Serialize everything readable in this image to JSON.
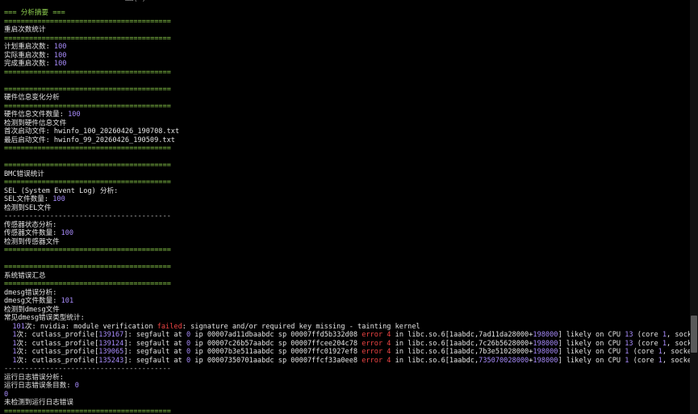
{
  "top_clip": "……(  )",
  "lines": [
    {
      "segs": [
        {
          "t": "=== 分析摘要 ===",
          "c": "g"
        }
      ]
    },
    {
      "segs": [
        {
          "t": "========================================",
          "c": "sep-g"
        }
      ]
    },
    {
      "segs": [
        {
          "t": "重启次数统计",
          "c": "t"
        }
      ]
    },
    {
      "segs": [
        {
          "t": "========================================",
          "c": "sep-g"
        }
      ]
    },
    {
      "segs": [
        {
          "t": "计划重启次数: ",
          "c": "t"
        },
        {
          "t": "100",
          "c": "n"
        }
      ]
    },
    {
      "segs": [
        {
          "t": "实际重启次数: ",
          "c": "t"
        },
        {
          "t": "100",
          "c": "n"
        }
      ]
    },
    {
      "segs": [
        {
          "t": "完成重启次数: ",
          "c": "t"
        },
        {
          "t": "100",
          "c": "n"
        }
      ]
    },
    {
      "segs": [
        {
          "t": "========================================",
          "c": "sep-g"
        }
      ]
    },
    {
      "segs": [
        {
          "t": "",
          "c": "t"
        }
      ]
    },
    {
      "segs": [
        {
          "t": "========================================",
          "c": "sep-g"
        }
      ]
    },
    {
      "segs": [
        {
          "t": "硬件信息变化分析",
          "c": "t"
        }
      ]
    },
    {
      "segs": [
        {
          "t": "========================================",
          "c": "sep-g"
        }
      ]
    },
    {
      "segs": [
        {
          "t": "硬件信息文件数量: ",
          "c": "t"
        },
        {
          "t": "100",
          "c": "n"
        }
      ]
    },
    {
      "segs": [
        {
          "t": "检测到硬件信息文件",
          "c": "t"
        }
      ]
    },
    {
      "segs": [
        {
          "t": "首次启动文件: hwinfo_100_20260426_190708.txt",
          "c": "t"
        }
      ]
    },
    {
      "segs": [
        {
          "t": "最后启动文件: hwinfo_99_20260426_190509.txt",
          "c": "t"
        }
      ]
    },
    {
      "segs": [
        {
          "t": "========================================",
          "c": "sep-g"
        }
      ]
    },
    {
      "segs": [
        {
          "t": "",
          "c": "t"
        }
      ]
    },
    {
      "segs": [
        {
          "t": "========================================",
          "c": "sep-g"
        }
      ]
    },
    {
      "segs": [
        {
          "t": "BMC错误统计",
          "c": "t"
        }
      ]
    },
    {
      "segs": [
        {
          "t": "========================================",
          "c": "sep-g"
        }
      ]
    },
    {
      "segs": [
        {
          "t": "SEL (System Event Log) 分析:",
          "c": "t"
        }
      ]
    },
    {
      "segs": [
        {
          "t": "SEL文件数量: ",
          "c": "t"
        },
        {
          "t": "100",
          "c": "n"
        }
      ]
    },
    {
      "segs": [
        {
          "t": "检测到SEL文件",
          "c": "t"
        }
      ]
    },
    {
      "segs": [
        {
          "t": "----------------------------------------",
          "c": "sep-w"
        }
      ]
    },
    {
      "segs": [
        {
          "t": "传感器状态分析:",
          "c": "t"
        }
      ]
    },
    {
      "segs": [
        {
          "t": "传感器文件数量: ",
          "c": "t"
        },
        {
          "t": "100",
          "c": "n"
        }
      ]
    },
    {
      "segs": [
        {
          "t": "检测到传感器文件",
          "c": "t"
        }
      ]
    },
    {
      "segs": [
        {
          "t": "========================================",
          "c": "sep-g"
        }
      ]
    },
    {
      "segs": [
        {
          "t": "",
          "c": "t"
        }
      ]
    },
    {
      "segs": [
        {
          "t": "========================================",
          "c": "sep-g"
        }
      ]
    },
    {
      "segs": [
        {
          "t": "系统错误汇总",
          "c": "t"
        }
      ]
    },
    {
      "segs": [
        {
          "t": "========================================",
          "c": "sep-g"
        }
      ]
    },
    {
      "segs": [
        {
          "t": "dmesg错误分析:",
          "c": "t"
        }
      ]
    },
    {
      "segs": [
        {
          "t": "dmesg文件数量: ",
          "c": "t"
        },
        {
          "t": "101",
          "c": "n"
        }
      ]
    },
    {
      "segs": [
        {
          "t": "检测到dmesg文件",
          "c": "t"
        }
      ]
    },
    {
      "segs": [
        {
          "t": "常见dmesg错误类型统计:",
          "c": "t"
        }
      ]
    },
    {
      "segs": [
        {
          "t": "  ",
          "c": "t"
        },
        {
          "t": "101",
          "c": "n"
        },
        {
          "t": "次: nvidia: module verification ",
          "c": "t"
        },
        {
          "t": "failed",
          "c": "r"
        },
        {
          "t": ": signature and/or required key missing - tainting kernel",
          "c": "t"
        }
      ]
    },
    {
      "segs": [
        {
          "t": "  ",
          "c": "t"
        },
        {
          "t": "1",
          "c": "n"
        },
        {
          "t": "次: cutlass_profile[",
          "c": "t"
        },
        {
          "t": "139167",
          "c": "n"
        },
        {
          "t": "]: segfault at ",
          "c": "t"
        },
        {
          "t": "0",
          "c": "n"
        },
        {
          "t": " ip 00007ad11dbaabdc sp 00007ffd5b332d08 ",
          "c": "t"
        },
        {
          "t": "error 4",
          "c": "r"
        },
        {
          "t": " in libc.so.6[1aabdc,7ad11da28000+",
          "c": "t"
        },
        {
          "t": "198000",
          "c": "n"
        },
        {
          "t": "] likely on CPU ",
          "c": "t"
        },
        {
          "t": "13",
          "c": "n"
        },
        {
          "t": " (core ",
          "c": "t"
        },
        {
          "t": "1",
          "c": "n"
        },
        {
          "t": ", socket ",
          "c": "t"
        },
        {
          "t": "0",
          "c": "n"
        },
        {
          "t": ")",
          "c": "t"
        }
      ]
    },
    {
      "segs": [
        {
          "t": "  ",
          "c": "t"
        },
        {
          "t": "1",
          "c": "n"
        },
        {
          "t": "次: cutlass_profile[",
          "c": "t"
        },
        {
          "t": "139124",
          "c": "n"
        },
        {
          "t": "]: segfault at ",
          "c": "t"
        },
        {
          "t": "0",
          "c": "n"
        },
        {
          "t": " ip 00007c26b57aabdc sp 00007ffcee204c78 ",
          "c": "t"
        },
        {
          "t": "error 4",
          "c": "r"
        },
        {
          "t": " in libc.so.6[1aabdc,7c26b5628000+",
          "c": "t"
        },
        {
          "t": "198000",
          "c": "n"
        },
        {
          "t": "] likely on CPU ",
          "c": "t"
        },
        {
          "t": "13",
          "c": "n"
        },
        {
          "t": " (core ",
          "c": "t"
        },
        {
          "t": "1",
          "c": "n"
        },
        {
          "t": ", socket ",
          "c": "t"
        },
        {
          "t": "0",
          "c": "n"
        },
        {
          "t": ")",
          "c": "t"
        }
      ]
    },
    {
      "segs": [
        {
          "t": "  ",
          "c": "t"
        },
        {
          "t": "1",
          "c": "n"
        },
        {
          "t": "次: cutlass_profile[",
          "c": "t"
        },
        {
          "t": "139065",
          "c": "n"
        },
        {
          "t": "]: segfault at ",
          "c": "t"
        },
        {
          "t": "0",
          "c": "n"
        },
        {
          "t": " ip 00007b3e511aabdc sp 00007ffc01927ef8 ",
          "c": "t"
        },
        {
          "t": "error 4",
          "c": "r"
        },
        {
          "t": " in libc.so.6[1aabdc,7b3e51028000+",
          "c": "t"
        },
        {
          "t": "198000",
          "c": "n"
        },
        {
          "t": "] likely on CPU ",
          "c": "t"
        },
        {
          "t": "1",
          "c": "n"
        },
        {
          "t": " (core ",
          "c": "t"
        },
        {
          "t": "1",
          "c": "n"
        },
        {
          "t": ", socket ",
          "c": "t"
        },
        {
          "t": "0",
          "c": "n"
        },
        {
          "t": ")",
          "c": "t"
        }
      ]
    },
    {
      "segs": [
        {
          "t": "  ",
          "c": "t"
        },
        {
          "t": "1",
          "c": "n"
        },
        {
          "t": "次: cutlass_profile[",
          "c": "t"
        },
        {
          "t": "135243",
          "c": "n"
        },
        {
          "t": "]: segfault at ",
          "c": "t"
        },
        {
          "t": "0",
          "c": "n"
        },
        {
          "t": " ip 00007350701aabdc sp 00007ffcf33a0ee8 ",
          "c": "t"
        },
        {
          "t": "error 4",
          "c": "r"
        },
        {
          "t": " in libc.so.6[1aabdc,",
          "c": "t"
        },
        {
          "t": "735070028000",
          "c": "n"
        },
        {
          "t": "+",
          "c": "t"
        },
        {
          "t": "198000",
          "c": "n"
        },
        {
          "t": "] likely on CPU ",
          "c": "t"
        },
        {
          "t": "1",
          "c": "n"
        },
        {
          "t": " (core ",
          "c": "t"
        },
        {
          "t": "1",
          "c": "n"
        },
        {
          "t": ", socket ",
          "c": "t"
        },
        {
          "t": "0",
          "c": "n"
        },
        {
          "t": ")",
          "c": "t"
        }
      ]
    },
    {
      "segs": [
        {
          "t": "----------------------------------------",
          "c": "sep-w"
        }
      ]
    },
    {
      "segs": [
        {
          "t": "运行日志错误分析:",
          "c": "t"
        }
      ]
    },
    {
      "segs": [
        {
          "t": "运行日志错误条目数: ",
          "c": "t"
        },
        {
          "t": "0",
          "c": "n"
        }
      ]
    },
    {
      "segs": [
        {
          "t": "0",
          "c": "n"
        }
      ]
    },
    {
      "segs": [
        {
          "t": "未检测到运行日志错误",
          "c": "t"
        }
      ]
    },
    {
      "segs": [
        {
          "t": "========================================",
          "c": "sep-g"
        }
      ]
    }
  ]
}
